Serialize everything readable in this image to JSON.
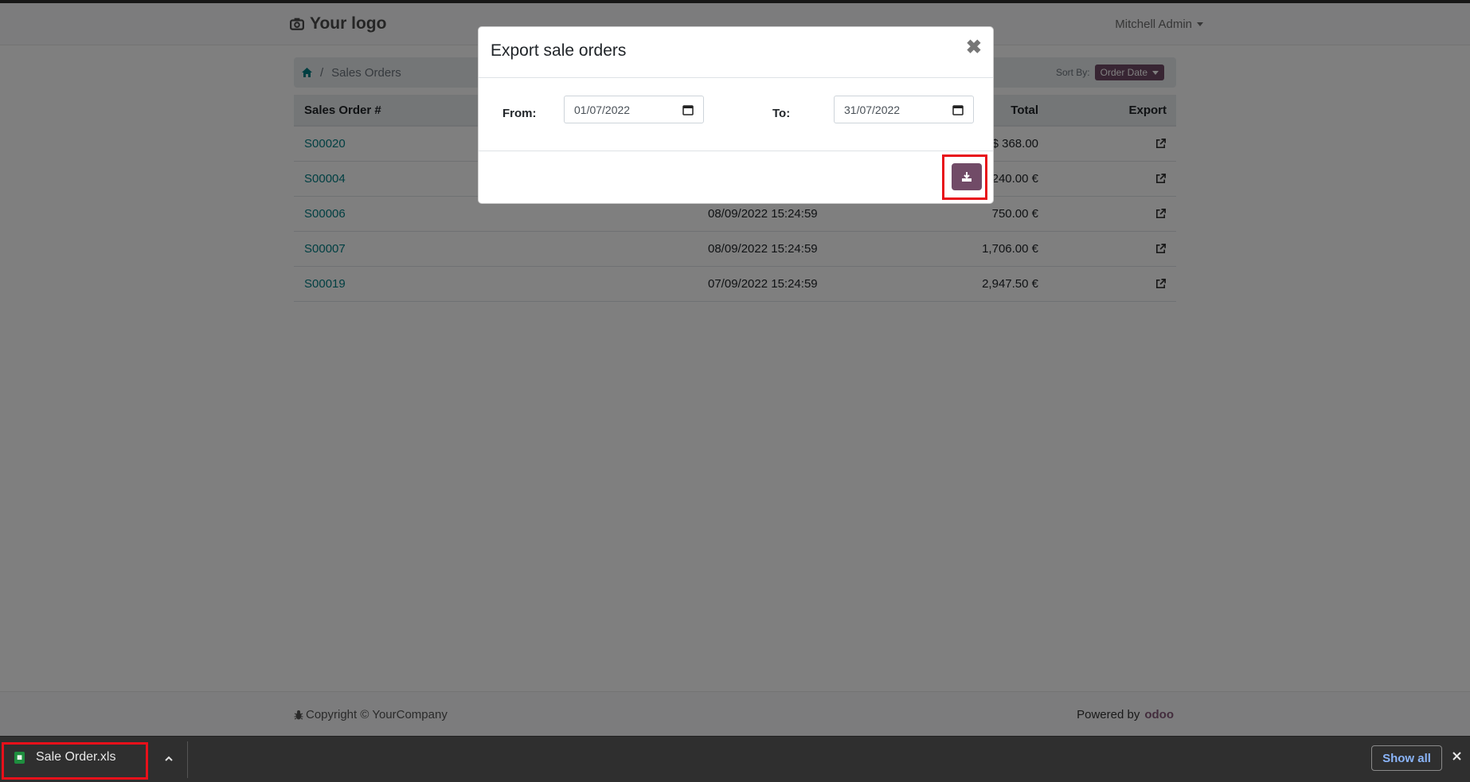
{
  "header": {
    "logo_text": "Your logo",
    "user_name": "Mitchell Admin"
  },
  "breadcrumb": {
    "current": "Sales Orders",
    "sort_label": "Sort By:",
    "sort_value": "Order Date"
  },
  "table": {
    "columns": {
      "order": "Sales Order #",
      "total": "Total",
      "export": "Export"
    },
    "rows": [
      {
        "order": "S00020",
        "date": "",
        "total": "$ 368.00"
      },
      {
        "order": "S00004",
        "date": "",
        "total": "240.00 €"
      },
      {
        "order": "S00006",
        "date": "08/09/2022  15:24:59",
        "total": "750.00 €"
      },
      {
        "order": "S00007",
        "date": "08/09/2022  15:24:59",
        "total": "1,706.00 €"
      },
      {
        "order": "S00019",
        "date": "07/09/2022  15:24:59",
        "total": "2,947.50 €"
      }
    ]
  },
  "footer": {
    "copyright": "Copyright © YourCompany",
    "powered_by": "Powered by",
    "odoo_logo_text": "odoo"
  },
  "modal": {
    "title": "Export sale orders",
    "close_glyph": "✖",
    "from_label": "From:",
    "from_value": "01/07/2022",
    "to_label": "To:",
    "to_value": "31/07/2022"
  },
  "download_bar": {
    "file_name": "Sale Order.xls",
    "show_all": "Show all"
  },
  "colors": {
    "brand": "#714b67",
    "link": "#017e84",
    "highlight": "#e8101a"
  }
}
